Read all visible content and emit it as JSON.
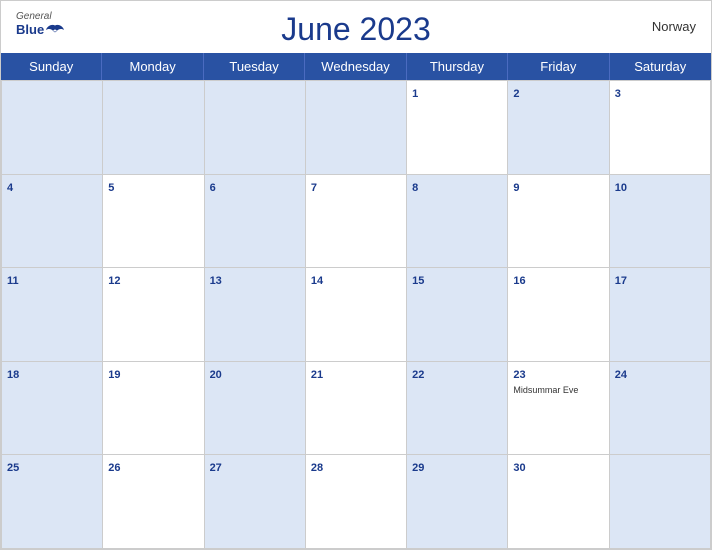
{
  "header": {
    "title": "June 2023",
    "country": "Norway",
    "logo": {
      "general": "General",
      "blue": "Blue"
    }
  },
  "days": [
    "Sunday",
    "Monday",
    "Tuesday",
    "Wednesday",
    "Thursday",
    "Friday",
    "Saturday"
  ],
  "weeks": [
    [
      {
        "date": "",
        "shaded": true
      },
      {
        "date": "",
        "shaded": true
      },
      {
        "date": "",
        "shaded": true
      },
      {
        "date": "",
        "shaded": true
      },
      {
        "date": "1",
        "shaded": false
      },
      {
        "date": "2",
        "shaded": true
      },
      {
        "date": "3",
        "shaded": false
      }
    ],
    [
      {
        "date": "4",
        "shaded": true
      },
      {
        "date": "5",
        "shaded": false
      },
      {
        "date": "6",
        "shaded": true
      },
      {
        "date": "7",
        "shaded": false
      },
      {
        "date": "8",
        "shaded": true
      },
      {
        "date": "9",
        "shaded": false
      },
      {
        "date": "10",
        "shaded": true
      }
    ],
    [
      {
        "date": "11",
        "shaded": true
      },
      {
        "date": "12",
        "shaded": false
      },
      {
        "date": "13",
        "shaded": true
      },
      {
        "date": "14",
        "shaded": false
      },
      {
        "date": "15",
        "shaded": true
      },
      {
        "date": "16",
        "shaded": false
      },
      {
        "date": "17",
        "shaded": true
      }
    ],
    [
      {
        "date": "18",
        "shaded": true
      },
      {
        "date": "19",
        "shaded": false
      },
      {
        "date": "20",
        "shaded": true
      },
      {
        "date": "21",
        "shaded": false
      },
      {
        "date": "22",
        "shaded": true
      },
      {
        "date": "23",
        "shaded": false,
        "event": "Midsummar Eve"
      },
      {
        "date": "24",
        "shaded": true
      }
    ],
    [
      {
        "date": "25",
        "shaded": true
      },
      {
        "date": "26",
        "shaded": false
      },
      {
        "date": "27",
        "shaded": true
      },
      {
        "date": "28",
        "shaded": false
      },
      {
        "date": "29",
        "shaded": true
      },
      {
        "date": "30",
        "shaded": false
      },
      {
        "date": "",
        "shaded": true
      }
    ]
  ],
  "colors": {
    "header_bg": "#2952a3",
    "shaded_cell": "#dce6f5",
    "date_color": "#1a3a8c"
  }
}
